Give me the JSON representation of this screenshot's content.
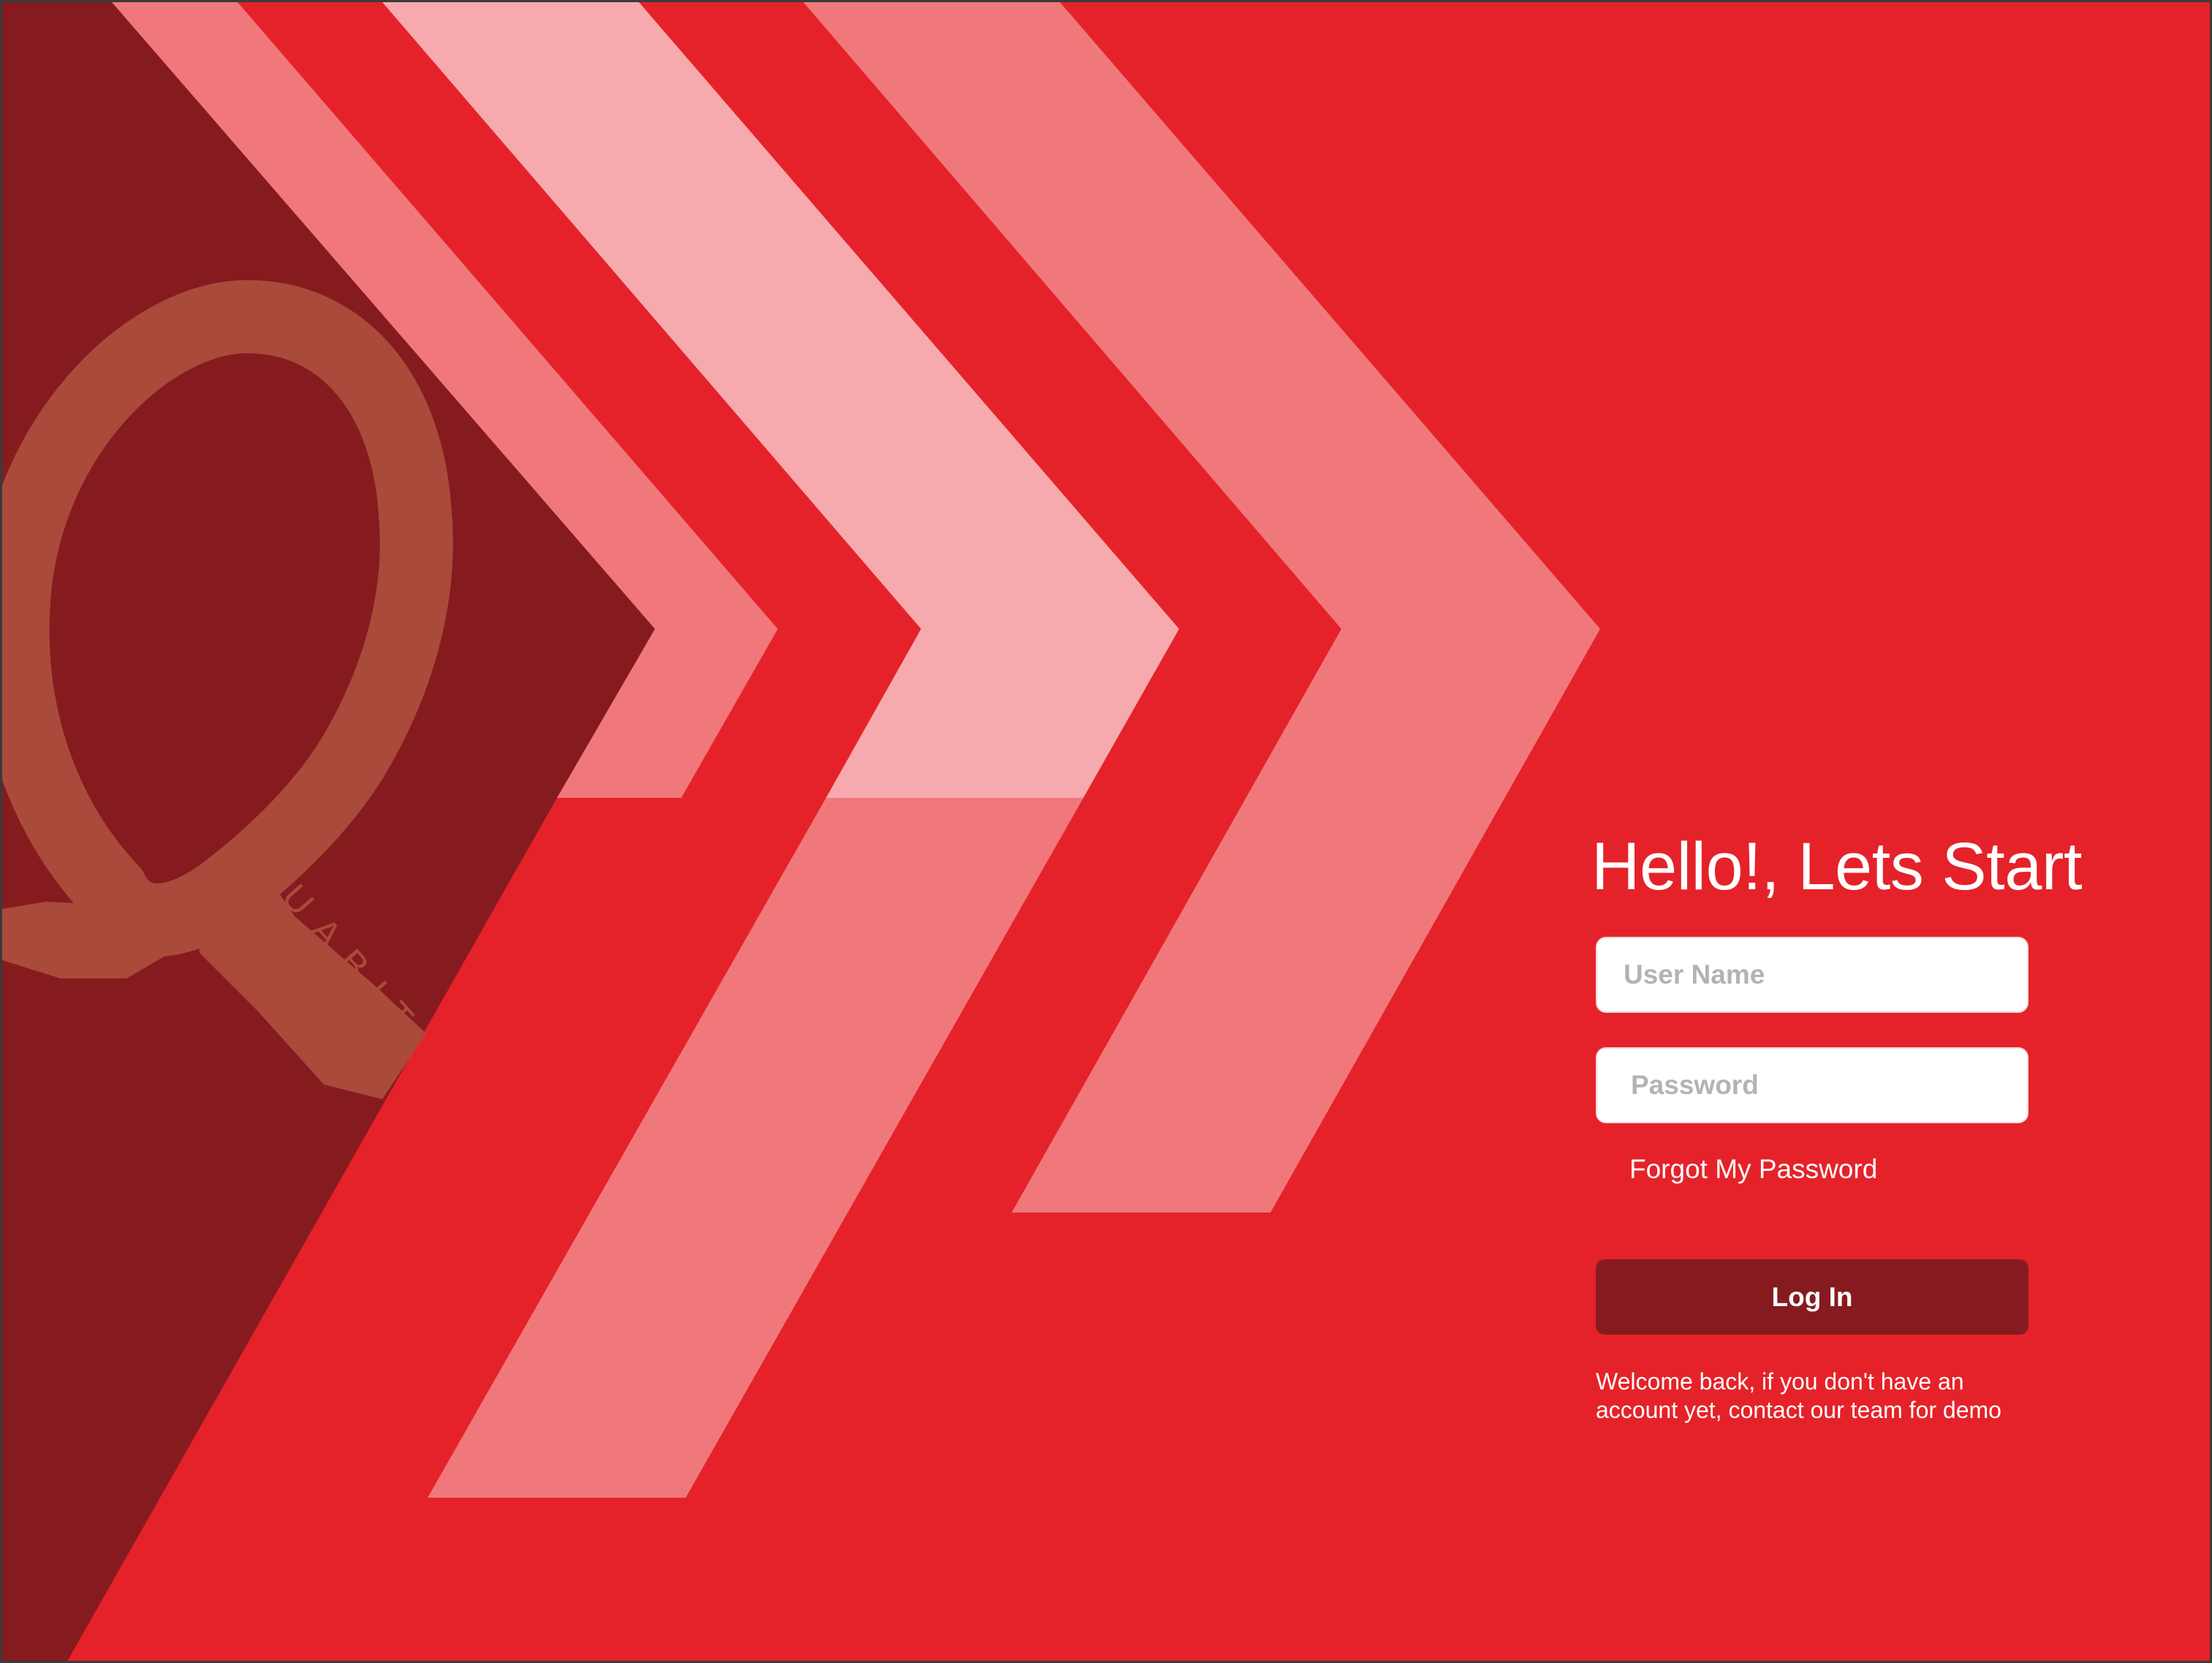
{
  "brand": {
    "logo_letter": "Q",
    "logo_text": "UABIT"
  },
  "colors": {
    "background": "#e52229",
    "dark_panel": "#861b1f",
    "stripe_mid": "#f0787b",
    "stripe_light": "#f6aaad",
    "logo": "#a94a3a",
    "button": "#861b1f",
    "text": "#ffffff",
    "placeholder": "#b3b3b3"
  },
  "login": {
    "heading": "Hello!, Lets Start",
    "username_placeholder": "User Name",
    "password_placeholder": "Password",
    "forgot_label": "Forgot My Password",
    "login_label": "Log In",
    "note_line1": "Welcome back, if you don't have an",
    "note_line2": "account yet, contact our team for demo"
  }
}
